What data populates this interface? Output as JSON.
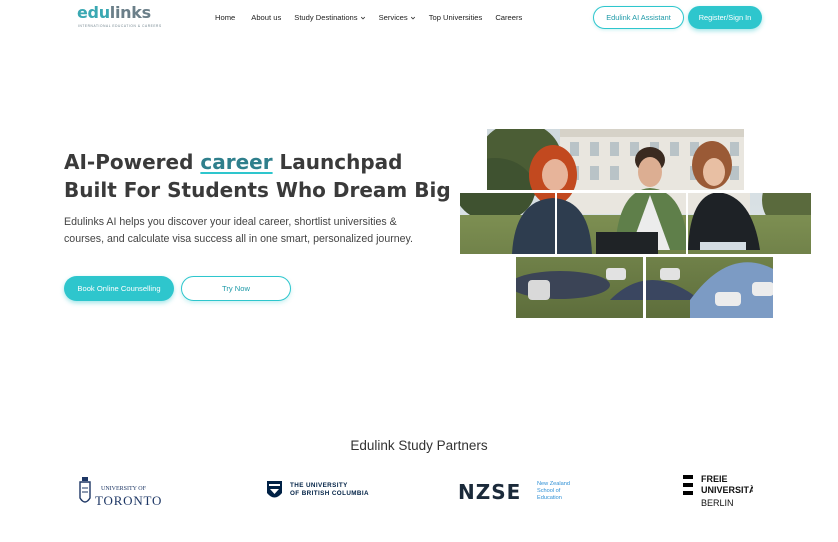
{
  "nav": {
    "logo": {
      "main": "edu",
      "tail": "links",
      "tagline": "INTERNATIONAL EDUCATION & CAREERS"
    },
    "items": [
      {
        "label": "Home",
        "dropdown": false
      },
      {
        "label": "About us",
        "dropdown": false
      },
      {
        "label": "Study Destinations",
        "dropdown": true
      },
      {
        "label": "Services",
        "dropdown": true
      },
      {
        "label": "Top Universities",
        "dropdown": false
      },
      {
        "label": "Careers",
        "dropdown": false
      }
    ],
    "ai_button": "Edulink AI Assistant",
    "register_button": "Register/Sign In"
  },
  "hero": {
    "title_part1": "AI-Powered ",
    "title_highlight": "career",
    "title_part2": " Launchpad Built For Students Who Dream Big",
    "description": "Edulinks AI helps you discover your ideal career, shortlist universities & courses, and calculate visa success all in one smart, personalized journey.",
    "book_button": "Book Online Counselling",
    "try_button": "Try Now"
  },
  "partners": {
    "title": "Edulink Study Partners",
    "toronto": {
      "line1": "UNIVERSITY OF",
      "line2": "TORONTO"
    },
    "ubc": {
      "badge": "UBC",
      "line1": "THE UNIVERSITY",
      "line2": "OF BRITISH COLUMBIA"
    },
    "nzse": {
      "mark": "NZSE",
      "line1": "New Zealand",
      "line2": "School of",
      "line3": "Education"
    },
    "fu": {
      "line1": "FREIE",
      "line2": "UNIVERSITÄT",
      "line3": "BERLIN"
    }
  },
  "colors": {
    "accent": "#2ec6cd",
    "accent_dark": "#1f9aa8",
    "heading": "#3a3a3a"
  }
}
